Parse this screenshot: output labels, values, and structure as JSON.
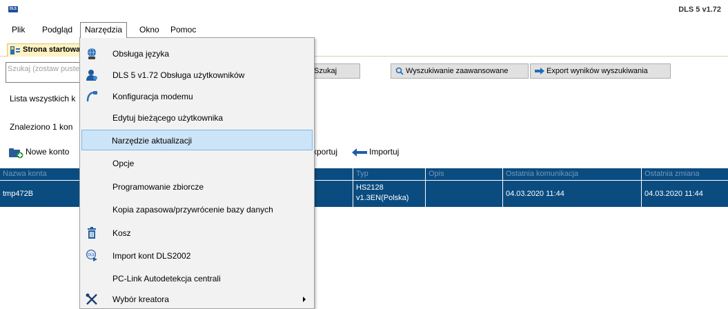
{
  "app": {
    "logo_text": "DLS",
    "version": "DLS 5 v1.72"
  },
  "menubar": [
    "Plik",
    "Podgląd",
    "Narzędzia",
    "Okno",
    "Pomoc"
  ],
  "tab": {
    "label": "Strona startowa"
  },
  "search": {
    "placeholder": "Szukaj (zostaw puste",
    "search_button": "Szukaj",
    "advanced_button": "Wyszukiwanie zaawansowane",
    "export_button": "Export wyników wyszukiwania"
  },
  "info": {
    "list_label": "Lista wszystkich k",
    "found_label": "Znaleziono 1 kon"
  },
  "toolbar": {
    "new_account": "Nowe konto",
    "export": "Exportuj",
    "import": "Importuj"
  },
  "table": {
    "headers": [
      "Nazwa konta",
      "Typ",
      "Opis",
      "Ostatnia komunikacja",
      "Ostatnia zmiana"
    ],
    "rows": [
      {
        "name": "tmp472B",
        "type_line1": "HS2128",
        "type_line2": "v1.3EN(Polska)",
        "description": "",
        "last_comm": "04.03.2020 11:44",
        "last_change": "04.03.2020 11:44"
      }
    ]
  },
  "tools_menu": {
    "items": [
      {
        "label": "Obsługa języka",
        "icon": "language-icon"
      },
      {
        "label": "DLS 5 v1.72 Obsługa użytkowników",
        "icon": "users-icon"
      },
      {
        "label": "Konfiguracja modemu",
        "icon": "modem-icon"
      },
      {
        "label": "Edytuj bieżącego użytkownika",
        "icon": ""
      },
      {
        "label": "Narzędzie aktualizacji",
        "icon": "",
        "highlighted": true
      },
      {
        "label": "Opcje",
        "icon": ""
      },
      {
        "label": "Programowanie zbiorcze",
        "icon": ""
      },
      {
        "label": "Kopia zapasowa/przywrócenie bazy danych",
        "icon": ""
      },
      {
        "label": "Kosz",
        "icon": "trash-icon"
      },
      {
        "label": "Import kont DLS2002",
        "icon": "import-dls-icon"
      },
      {
        "label": "PC-Link Autodetekcja centrali",
        "icon": ""
      },
      {
        "label": "Wybór kreatora",
        "icon": "wizard-tools-icon",
        "submenu": true
      }
    ]
  },
  "colors": {
    "selection": "#0b4c80",
    "menu_highlight": "#cce4f7",
    "tab_background": "#fff3c4"
  }
}
